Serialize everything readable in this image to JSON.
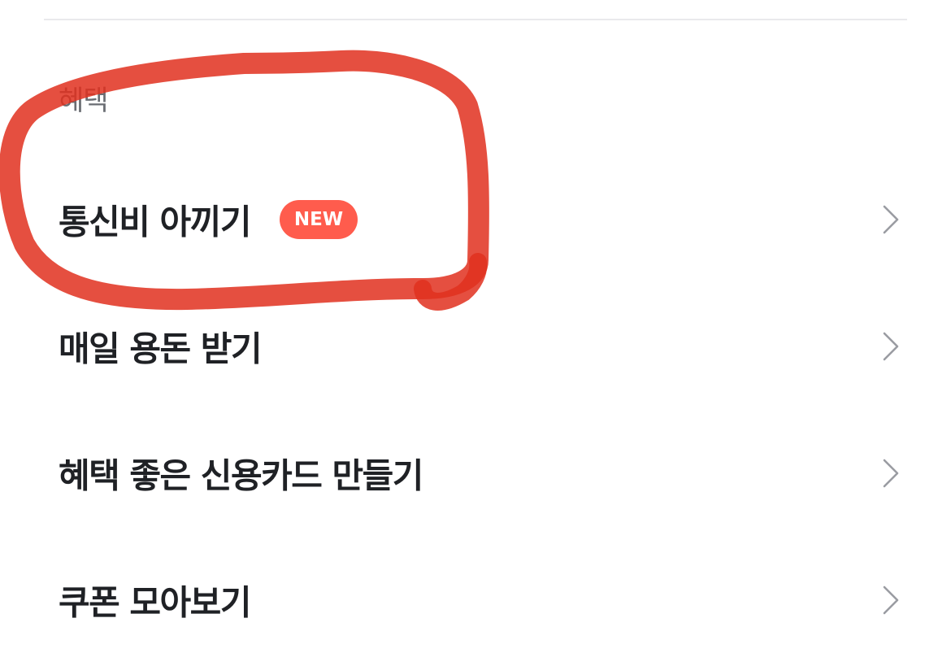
{
  "section": {
    "title": "혜택"
  },
  "menu": {
    "items": [
      {
        "label": "통신비 아끼기",
        "badge": "NEW"
      },
      {
        "label": "매일 용돈 받기"
      },
      {
        "label": "혜택 좋은 신용카드 만들기"
      },
      {
        "label": "쿠폰 모아보기"
      }
    ]
  },
  "icons": {
    "chevron": "chevron-right-icon"
  },
  "colors": {
    "badge": "#ff5c4d",
    "annotation_stroke": "#e0301e",
    "text_primary": "#1f2125",
    "text_secondary": "#6a6d73",
    "chevron": "#9a9ca2",
    "divider": "#e9e9ec"
  }
}
